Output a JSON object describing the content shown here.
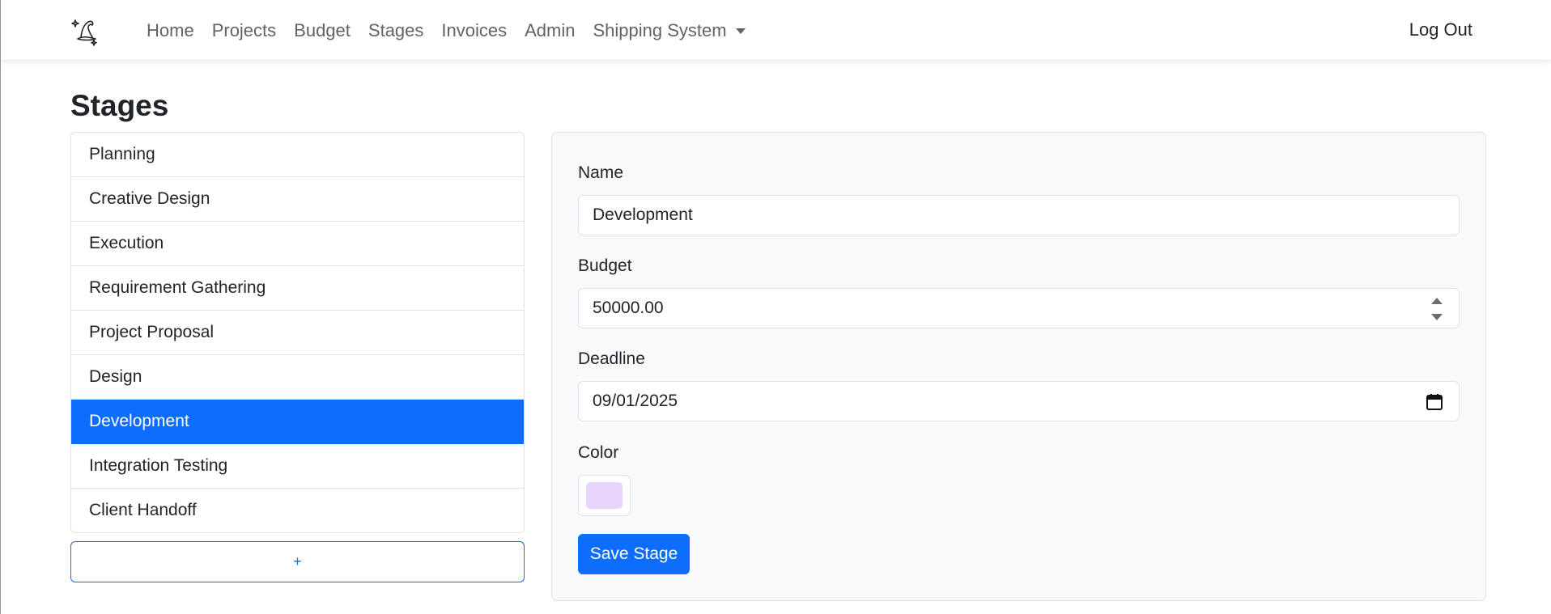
{
  "nav": {
    "brand_icon": "wizard-hat-sparkles-icon",
    "links": [
      {
        "label": "Home"
      },
      {
        "label": "Projects"
      },
      {
        "label": "Budget"
      },
      {
        "label": "Stages"
      },
      {
        "label": "Invoices"
      },
      {
        "label": "Admin"
      },
      {
        "label": "Shipping System"
      }
    ],
    "logout_label": "Log Out"
  },
  "page": {
    "title": "Stages"
  },
  "stages": {
    "items": [
      {
        "label": "Planning"
      },
      {
        "label": "Creative Design"
      },
      {
        "label": "Execution"
      },
      {
        "label": "Requirement Gathering"
      },
      {
        "label": "Project Proposal"
      },
      {
        "label": "Design"
      },
      {
        "label": "Development"
      },
      {
        "label": "Integration Testing"
      },
      {
        "label": "Client Handoff"
      }
    ],
    "selected": "Development",
    "add_label": "+"
  },
  "form": {
    "name_label": "Name",
    "name_value": "Development",
    "budget_label": "Budget",
    "budget_value": "50000.00",
    "deadline_label": "Deadline",
    "deadline_value": "09/01/2025",
    "color_label": "Color",
    "color_value": "#e8d5fb",
    "save_label": "Save Stage"
  },
  "colors": {
    "primary": "#0d6efd",
    "card_bg": "#f8f9fa",
    "border": "#dee2e6"
  }
}
